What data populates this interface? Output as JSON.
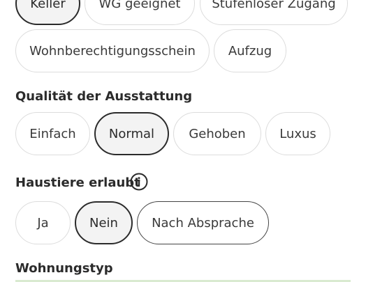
{
  "features": {
    "row1": [
      {
        "label": "Keller",
        "selected": true
      },
      {
        "label": "WG geeignet",
        "selected": false
      },
      {
        "label": "Stufenloser Zugang",
        "selected": false
      }
    ],
    "row2": [
      {
        "label": "Wohnberechtigungsschein",
        "selected": false
      },
      {
        "label": "Aufzug",
        "selected": false
      }
    ]
  },
  "quality": {
    "heading": "Qualität der Ausstattung",
    "options": [
      {
        "label": "Einfach",
        "selected": false
      },
      {
        "label": "Normal",
        "selected": true
      },
      {
        "label": "Gehoben",
        "selected": false
      },
      {
        "label": "Luxus",
        "selected": false
      }
    ]
  },
  "pets": {
    "heading": "Haustiere erlaubt",
    "info_icon": "info-icon",
    "options": [
      {
        "label": "Ja",
        "selected": false
      },
      {
        "label": "Nein",
        "selected": true
      },
      {
        "label": "Nach Absprache",
        "selected": false
      }
    ]
  },
  "apartment_type": {
    "heading": "Wohnungstyp"
  },
  "colors": {
    "selected_border": "#2b2b2b",
    "selected_fill": "#f3f3f3",
    "chip_border": "#dcdcdc",
    "accent_strip": "#d9ead0"
  }
}
